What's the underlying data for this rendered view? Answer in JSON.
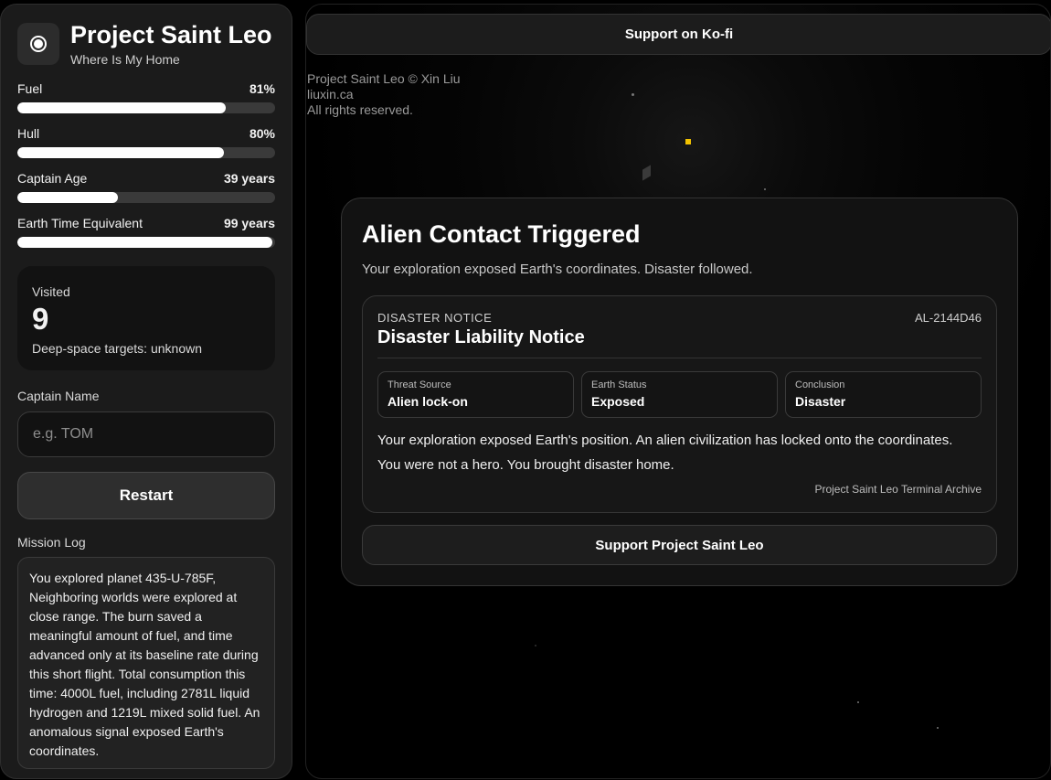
{
  "sidebar": {
    "title": "Project Saint Leo",
    "subtitle": "Where Is My Home",
    "stats": [
      {
        "label": "Fuel",
        "value": "81%",
        "fill": 0.81
      },
      {
        "label": "Hull",
        "value": "80%",
        "fill": 0.8
      },
      {
        "label": "Captain Age",
        "value": "39 years",
        "fill": 0.39
      },
      {
        "label": "Earth Time Equivalent",
        "value": "99 years",
        "fill": 0.99
      }
    ],
    "visited": {
      "label": "Visited",
      "count": "9",
      "note": "Deep-space targets: unknown"
    },
    "captain_name_label": "Captain Name",
    "captain_name_placeholder": "e.g. TOM",
    "restart_label": "Restart",
    "mission_log_label": "Mission Log",
    "mission_log": "You explored planet 435-U-785F, Neighboring worlds were explored at close range. The burn saved a meaningful amount of fuel, and time advanced only at its baseline rate during this short flight. Total consumption this time: 4000L fuel, including 2781L liquid hydrogen and 1219L mixed solid fuel. An anomalous signal exposed Earth's coordinates."
  },
  "main": {
    "kofi_label": "Support on Ko-fi",
    "credits": [
      "Project Saint Leo © Xin Liu",
      "liuxin.ca",
      "All rights reserved."
    ],
    "card": {
      "title": "Alien Contact Triggered",
      "subtitle": "Your exploration exposed Earth's coordinates. Disaster followed.",
      "notice": {
        "kicker": "DISASTER NOTICE",
        "title": "Disaster Liability Notice",
        "code": "AL-2144D46",
        "facts": [
          {
            "k": "Threat Source",
            "v": "Alien lock-on"
          },
          {
            "k": "Earth Status",
            "v": "Exposed"
          },
          {
            "k": "Conclusion",
            "v": "Disaster"
          }
        ],
        "body": [
          "Your exploration exposed Earth's position. An alien civilization has locked onto the coordinates.",
          "You were not a hero. You brought disaster home."
        ],
        "footer": "Project Saint Leo Terminal Archive"
      },
      "support_label": "Support Project Saint Leo"
    }
  },
  "colors": {
    "accent_star": "#f2c200",
    "background": "#000000",
    "panel": "#1b1b1b"
  }
}
